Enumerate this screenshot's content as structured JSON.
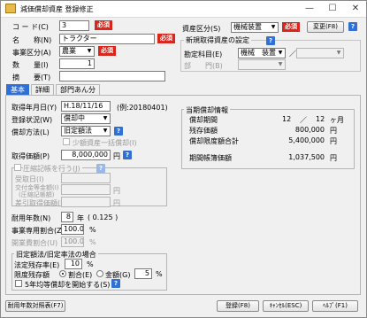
{
  "window": {
    "title": "減価償却資産 登録修正",
    "minimize": "—",
    "maximize": "☐",
    "close": "✕"
  },
  "header": {
    "code_label": "コ ー ド(C)",
    "code_value": "3",
    "required": "必須",
    "name_label": "名　　称(N)",
    "name_value": "トラクター",
    "business_label": "事業区分(A)",
    "business_value": "農業",
    "qty_label": "数　　量(I)",
    "qty_value": "1",
    "summary_label": "摘　　要(T)",
    "summary_value": "",
    "asset_class_label": "資産区分(S)",
    "asset_class_value": "機械装置",
    "change_button": "変更(F8)",
    "new_setting_group": "新規取得資産の設定",
    "account_label": "勘定科目(E)",
    "account_value": "機械　装置",
    "account_sep": "／",
    "dept_label": "部　　門(B)"
  },
  "tabs": [
    "基本",
    "詳細",
    "部門あん分"
  ],
  "basic": {
    "acq_date_label": "取得年月日(Y)",
    "acq_date_value": "H.18/11/16",
    "acq_date_example": "(例:20180401)",
    "reg_status_label": "登録状況(W)",
    "reg_status_value": "償却中",
    "method_label": "償却方法(L)",
    "method_value": "旧定額法",
    "lump_label": "少額資産一括償却(I)",
    "cost_label": "取得価額(P)",
    "cost_value": "8,000,000",
    "yen": "円",
    "compressed_label": "圧縮記帳を行う(J)",
    "received_label": "受取日(I)",
    "subsidy_label": "交付金等金額(I)",
    "subsidy_sub": "(圧縮記帳額)",
    "deduct_label": "差引取得価額(I)",
    "life_label": "耐用年数(N)",
    "life_value": "8",
    "life_unit": "年",
    "life_rate": "( 0.125 )",
    "ratio_label": "事業専用割合(Z)",
    "ratio_value": "100.00",
    "pct": "%",
    "pre_business_label": "開業費割合(U)",
    "pre_business_value": "100.00",
    "old_group": "旧定額法/旧定率法の場合",
    "salvage_label": "法定残存率(E)",
    "salvage_value": "10",
    "salvage_unit": "%",
    "limit_label": "限度残存額",
    "radio_ratio": "割合(E)",
    "radio_amount": "金額(G)",
    "limit_value": "5",
    "limit_unit": "%",
    "five_year_label": "5年均等償却を開始する(S)"
  },
  "current": {
    "group": "当期償却情報",
    "months_label": "償却期間",
    "months_value": "12",
    "months_sep": "／",
    "months_total": "12",
    "months_unit": "ヶ月",
    "remain_label": "残存価額",
    "remain_value": "800,000",
    "remain_unit": "円",
    "limit_total_label": "償却限度額合計",
    "limit_total_value": "5,400,000",
    "limit_total_unit": "円",
    "period_label": "期間帳簿価額",
    "period_value": "1,037,500",
    "period_unit": "円"
  },
  "footer": {
    "lifetable_button": "耐用年数対照表(F7)",
    "save_button": "登録(F8)",
    "cancel_button": "ｷｬﾝｾﾙ(ESC)",
    "help_button": "ﾍﾙﾌﾟ(F1)"
  }
}
